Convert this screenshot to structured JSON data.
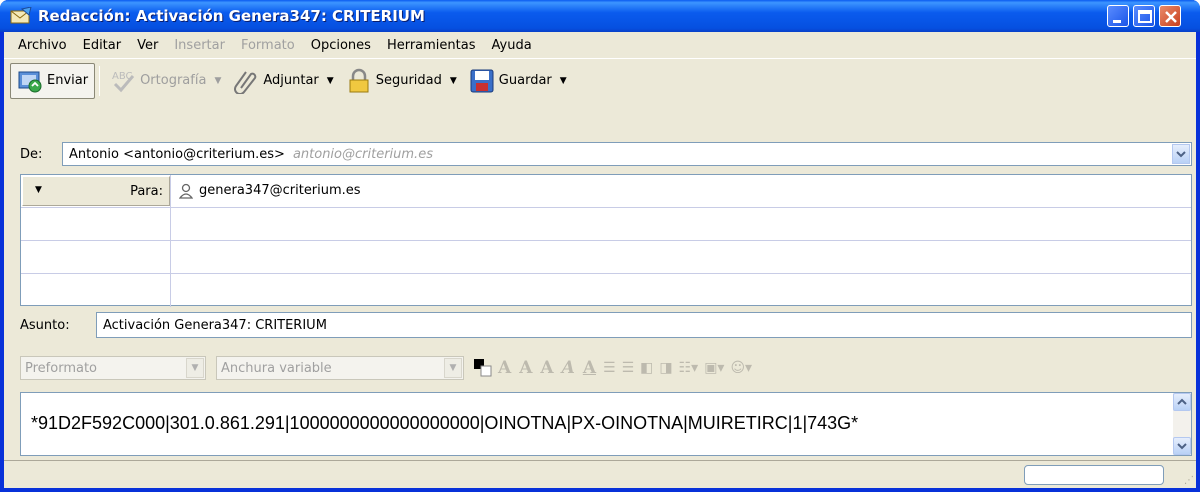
{
  "window": {
    "title": "Redacción: Activación Genera347: CRITERIUM"
  },
  "menu": [
    {
      "label": "Archivo",
      "enabled": true
    },
    {
      "label": "Editar",
      "enabled": true
    },
    {
      "label": "Ver",
      "enabled": true
    },
    {
      "label": "Insertar",
      "enabled": false
    },
    {
      "label": "Formato",
      "enabled": false
    },
    {
      "label": "Opciones",
      "enabled": true
    },
    {
      "label": "Herramientas",
      "enabled": true
    },
    {
      "label": "Ayuda",
      "enabled": true
    }
  ],
  "toolbar": {
    "send_label": "Enviar",
    "spell_label": "Ortografía",
    "attach_label": "Adjuntar",
    "security_label": "Seguridad",
    "save_label": "Guardar"
  },
  "header": {
    "from_label": "De:",
    "from_value": "Antonio <antonio@criterium.es>",
    "from_hint": "antonio@criterium.es",
    "to_label": "Para:",
    "to_value": "genera347@criterium.es",
    "subject_label": "Asunto:",
    "subject_value": "Activación Genera347: CRITERIUM"
  },
  "format_bar": {
    "paragraph_format": "Preformato",
    "font_width": "Anchura variable"
  },
  "body": {
    "text": "*91D2F592C000|301.0.861.291|1000000000000000000|OINOTNA|PX-OINOTNA|MUIRETIRC|1|743G*"
  },
  "colors": {
    "titlebar": "#0A5BEE",
    "frame": "#ECE9D8",
    "field_border": "#7F9DB9"
  }
}
